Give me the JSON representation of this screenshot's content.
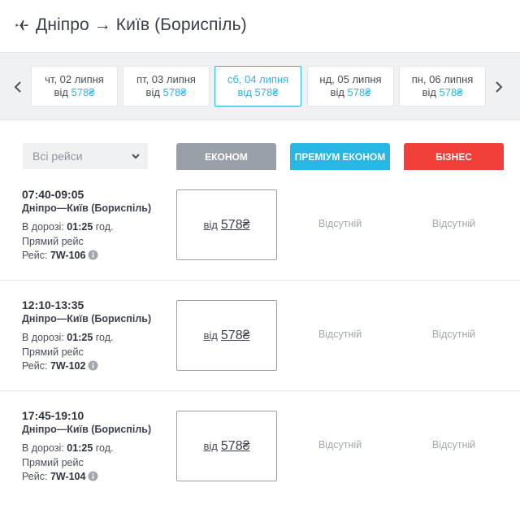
{
  "header": {
    "title": "Дніпро → Київ (Бориспіль)",
    "icon": "plane-icon"
  },
  "dates": [
    {
      "day": "чт, 02 липня",
      "from": "від",
      "price": "578₴",
      "active": false
    },
    {
      "day": "пт, 03 липня",
      "from": "від",
      "price": "578₴",
      "active": false
    },
    {
      "day": "сб, 04 липня",
      "from": "від",
      "price": "578₴",
      "active": true
    },
    {
      "day": "нд, 05 липня",
      "from": "від",
      "price": "578₴",
      "active": false
    },
    {
      "day": "пн, 06 липня",
      "from": "від",
      "price": "578₴",
      "active": false
    }
  ],
  "filter": {
    "selected": "Всі рейси"
  },
  "classes": {
    "econom": "ЕКОНОМ",
    "premium": "ПРЕМІУМ ЕКОНОМ",
    "business": "БІЗНЕС"
  },
  "colors": {
    "accent": "#2fb4e6",
    "econom": "#9aa0a8",
    "premium": "#28b6e5",
    "business": "#f23f3a"
  },
  "flights": [
    {
      "time": "07:40-09:05",
      "route": "Дніпро—Київ (Бориспіль)",
      "duration_label": "В дорозі:",
      "duration": "01:25",
      "duration_unit": "год.",
      "direct": "Прямий рейс",
      "flight_label": "Рейс:",
      "flight": "7W-106",
      "price_from": "від",
      "price": "578₴",
      "premium": "Відсутній",
      "business": "Відсутній"
    },
    {
      "time": "12:10-13:35",
      "route": "Дніпро—Київ (Бориспіль)",
      "duration_label": "В дорозі:",
      "duration": "01:25",
      "duration_unit": "год.",
      "direct": "Прямий рейс",
      "flight_label": "Рейс:",
      "flight": "7W-102",
      "price_from": "від",
      "price": "578₴",
      "premium": "Відсутній",
      "business": "Відсутній"
    },
    {
      "time": "17:45-19:10",
      "route": "Дніпро—Київ (Бориспіль)",
      "duration_label": "В дорозі:",
      "duration": "01:25",
      "duration_unit": "год.",
      "direct": "Прямий рейс",
      "flight_label": "Рейс:",
      "flight": "7W-104",
      "price_from": "від",
      "price": "578₴",
      "premium": "Відсутній",
      "business": "Відсутній"
    }
  ]
}
